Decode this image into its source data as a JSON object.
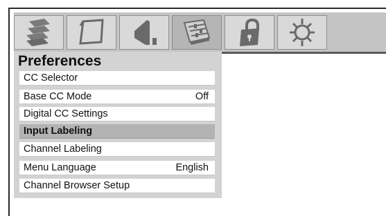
{
  "menu_tabs": [
    {
      "icon": "setup-list-icon",
      "active": false
    },
    {
      "icon": "picture-icon",
      "active": false
    },
    {
      "icon": "audio-icon",
      "active": false
    },
    {
      "icon": "preferences-icon",
      "active": true
    },
    {
      "icon": "lock-icon",
      "active": false
    },
    {
      "icon": "settings-gear-icon",
      "active": false
    }
  ],
  "panel": {
    "title": "Preferences",
    "items": [
      {
        "label": "CC Selector",
        "value": ""
      },
      {
        "label": "Base CC Mode",
        "value": "Off"
      },
      {
        "label": "Digital CC Settings",
        "value": ""
      },
      {
        "label": "Input Labeling",
        "value": "",
        "selected": true
      },
      {
        "label": "Channel Labeling",
        "value": ""
      },
      {
        "label": "Menu Language",
        "value": "English"
      },
      {
        "label": "Channel Browser Setup",
        "value": ""
      }
    ]
  },
  "colors": {
    "selected_row": "#b3b3b3",
    "panel_bg": "#d3d3d3",
    "iconbar_bg": "#c4c4c4"
  }
}
